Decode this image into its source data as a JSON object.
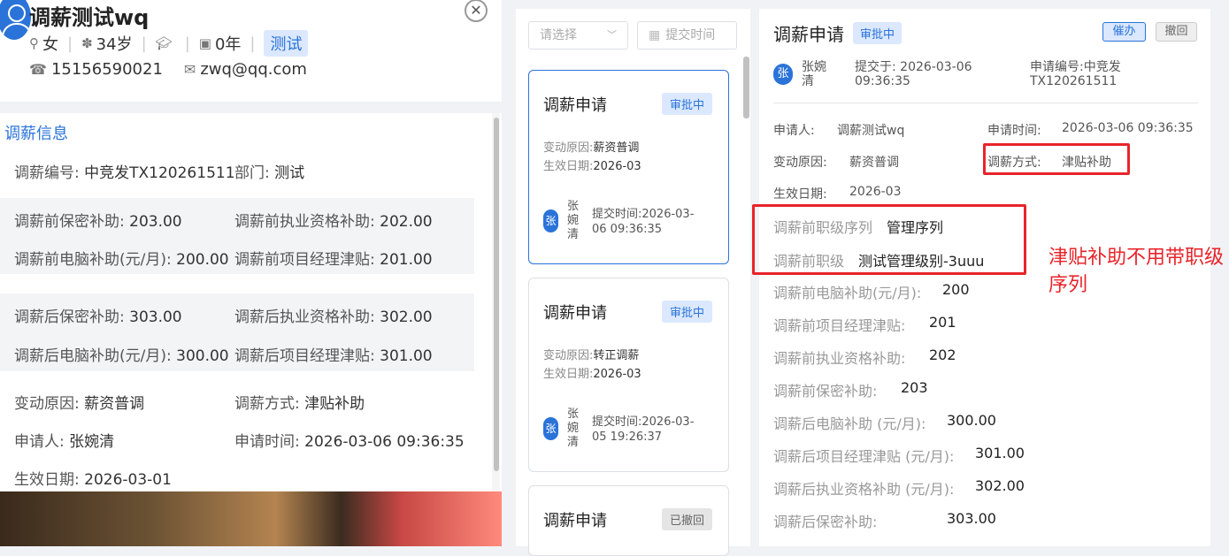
{
  "left": {
    "name": "调薪测试wq",
    "gender": "女",
    "age": "34岁",
    "tenure": "0年",
    "dept_tag": "测试",
    "phone": "15156590021",
    "email": "zwq@qq.com",
    "section_title": "调薪信息",
    "fields": {
      "code_label": "调薪编号:",
      "code_value": "中竞发TX120261511",
      "dept_label": "部门:",
      "dept_value": "测试",
      "pre_secret_label": "调薪前保密补助:",
      "pre_secret_value": "203.00",
      "pre_qual_label": "调薪前执业资格补助:",
      "pre_qual_value": "202.00",
      "pre_pc_label": "调薪前电脑补助(元/月):",
      "pre_pc_value": "200.00",
      "pre_pm_label": "调薪前项目经理津贴:",
      "pre_pm_value": "201.00",
      "post_secret_label": "调薪后保密补助:",
      "post_secret_value": "303.00",
      "post_qual_label": "调薪后执业资格补助:",
      "post_qual_value": "302.00",
      "post_pc_label": "调薪后电脑补助(元/月):",
      "post_pc_value": "300.00",
      "post_pm_label": "调薪后项目经理津贴:",
      "post_pm_value": "301.00",
      "reason_label": "变动原因:",
      "reason_value": "薪资普调",
      "method_label": "调薪方式:",
      "method_value": "津贴补助",
      "applicant_label": "申请人:",
      "applicant_value": "张婉清",
      "apply_time_label": "申请时间:",
      "apply_time_value": "2026-03-06 09:36:35",
      "effective_label": "生效日期:",
      "effective_value": "2026-03-01"
    }
  },
  "list": {
    "filter_placeholder": "请选择",
    "date_placeholder": "提交时间",
    "cards": [
      {
        "title": "调薪申请",
        "status": "审批中",
        "reason_label": "变动原因:",
        "reason": "薪资普调",
        "eff_label": "生效日期:",
        "eff": "2026-03",
        "avatar": "张",
        "name": "张婉清",
        "time_label": "提交时间:",
        "time": "2026-03-06 09:36:35"
      },
      {
        "title": "调薪申请",
        "status": "审批中",
        "reason_label": "变动原因:",
        "reason": "转正调薪",
        "eff_label": "生效日期:",
        "eff": "2026-03",
        "avatar": "张",
        "name": "张婉清",
        "time_label": "提交时间:",
        "time": "2026-03-05 19:26:37"
      },
      {
        "title": "调薪申请",
        "status": "已撤回"
      }
    ]
  },
  "detail": {
    "title": "调薪申请",
    "status": "审批中",
    "urge_label": "催办",
    "revoke_label": "撤回",
    "avatar": "张",
    "submitter": "张婉清",
    "submit_label": "提交于:",
    "submit_time": "2026-03-06 09:36:35",
    "req_no_label": "申请编号:",
    "req_no": "中竞发TX120261511",
    "applicant_label": "申请人:",
    "applicant": "调薪测试wq",
    "apply_time_label": "申请时间:",
    "apply_time": "2026-03-06 09:36:35",
    "reason_label": "变动原因:",
    "reason": "薪资普调",
    "method_label": "调薪方式:",
    "method": "津贴补助",
    "effective_label": "生效日期:",
    "effective": "2026-03",
    "rank_seq_label": "调薪前职级序列",
    "rank_seq": "管理序列",
    "rank_label": "调薪前职级",
    "rank": "测试管理级别-3uuu",
    "rows": [
      {
        "label": "调薪前电脑补助(元/月):",
        "value": "200"
      },
      {
        "label": "调薪前项目经理津贴:",
        "value": "201"
      },
      {
        "label": "调薪前执业资格补助:",
        "value": "202"
      },
      {
        "label": "调薪前保密补助:",
        "value": "203"
      },
      {
        "label": "调薪后电脑补助 (元/月):",
        "value": "300.00"
      },
      {
        "label": "调薪后项目经理津贴 (元/月):",
        "value": "301.00"
      },
      {
        "label": "调薪后执业资格补助 (元/月):",
        "value": "302.00"
      },
      {
        "label": "调薪后保密补助:",
        "value": "303.00"
      }
    ]
  },
  "annotation": "津贴补助不用带职级序列",
  "colors": {
    "accent": "#2a73d9",
    "annotation": "#e8242a"
  }
}
